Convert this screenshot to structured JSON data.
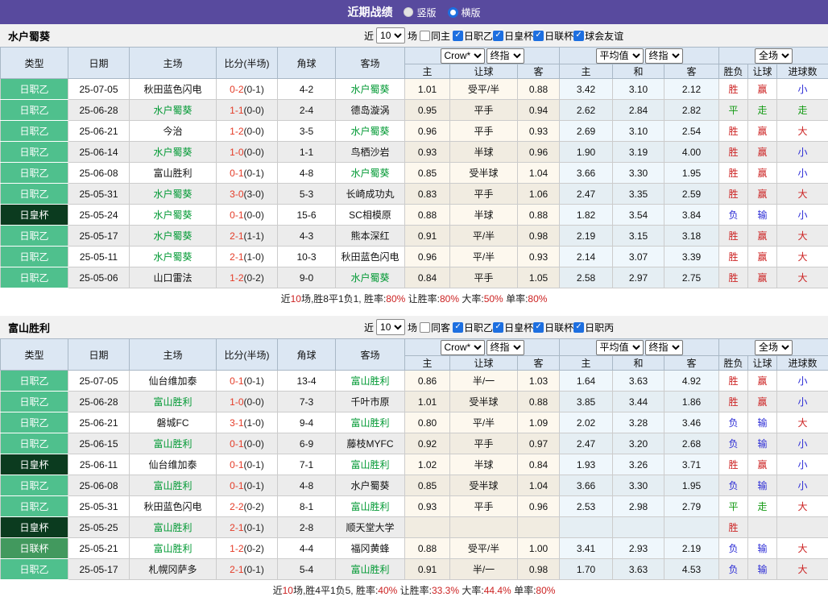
{
  "colors": {
    "topbar": "#584a9e",
    "headerBg": "#dce7f3",
    "check": "#1d6fe0",
    "j2": "#4fc08d",
    "cup": "#0b3b1f",
    "lc": "#42995e",
    "hl": "#009933",
    "score": "#e43c28",
    "red": "#cc2222",
    "green": "#149a14",
    "blue": "#2b2bd5",
    "cream": "#fdf8ee",
    "avg": "#eff7fc"
  },
  "topbar": {
    "title": "近期战绩",
    "options": [
      {
        "label": "竖版",
        "checked": false
      },
      {
        "label": "横版",
        "checked": true
      }
    ]
  },
  "sections": [
    {
      "team": "水户蜀葵",
      "filter": {
        "near": "近",
        "count": "10",
        "games": "场",
        "same_label": "同主",
        "leagues": [
          "日职乙",
          "日皇杯",
          "日联杯",
          "球会友谊"
        ]
      },
      "header": {
        "left": [
          "类型",
          "日期",
          "主场",
          "比分(半场)",
          "角球",
          "客场"
        ],
        "selects": [
          "Crow*",
          "终指",
          "平均值",
          "终指",
          "全场"
        ],
        "sub": [
          "主",
          "让球",
          "客",
          "主",
          "和",
          "客",
          "胜负",
          "让球",
          "进球数"
        ]
      },
      "rows": [
        {
          "type": "日职乙",
          "date": "25-07-05",
          "home": "秋田蓝色闪电",
          "home_hl": false,
          "ft": "0-2",
          "ht": "(0-1)",
          "corner": "4-2",
          "away": "水户蜀葵",
          "away_hl": true,
          "crow": [
            "1.01",
            "受平/半",
            "0.88"
          ],
          "avg": [
            "3.42",
            "3.10",
            "2.12"
          ],
          "res": [
            "胜",
            "赢",
            "小"
          ]
        },
        {
          "type": "日职乙",
          "date": "25-06-28",
          "home": "水户蜀葵",
          "home_hl": true,
          "ft": "1-1",
          "ht": "(0-0)",
          "corner": "2-4",
          "away": "德岛漩涡",
          "away_hl": false,
          "crow": [
            "0.95",
            "平手",
            "0.94"
          ],
          "avg": [
            "2.62",
            "2.84",
            "2.82"
          ],
          "res": [
            "平",
            "走",
            "走"
          ]
        },
        {
          "type": "日职乙",
          "date": "25-06-21",
          "home": "今治",
          "home_hl": false,
          "ft": "1-2",
          "ht": "(0-0)",
          "corner": "3-5",
          "away": "水户蜀葵",
          "away_hl": true,
          "crow": [
            "0.96",
            "平手",
            "0.93"
          ],
          "avg": [
            "2.69",
            "3.10",
            "2.54"
          ],
          "res": [
            "胜",
            "赢",
            "大"
          ]
        },
        {
          "type": "日职乙",
          "date": "25-06-14",
          "home": "水户蜀葵",
          "home_hl": true,
          "ft": "1-0",
          "ht": "(0-0)",
          "corner": "1-1",
          "away": "鸟栖沙岩",
          "away_hl": false,
          "crow": [
            "0.93",
            "半球",
            "0.96"
          ],
          "avg": [
            "1.90",
            "3.19",
            "4.00"
          ],
          "res": [
            "胜",
            "赢",
            "小"
          ]
        },
        {
          "type": "日职乙",
          "date": "25-06-08",
          "home": "富山胜利",
          "home_hl": false,
          "ft": "0-1",
          "ht": "(0-1)",
          "corner": "4-8",
          "away": "水户蜀葵",
          "away_hl": true,
          "crow": [
            "0.85",
            "受半球",
            "1.04"
          ],
          "avg": [
            "3.66",
            "3.30",
            "1.95"
          ],
          "res": [
            "胜",
            "赢",
            "小"
          ]
        },
        {
          "type": "日职乙",
          "date": "25-05-31",
          "home": "水户蜀葵",
          "home_hl": true,
          "ft": "3-0",
          "ht": "(3-0)",
          "corner": "5-3",
          "away": "长崎成功丸",
          "away_hl": false,
          "crow": [
            "0.83",
            "平手",
            "1.06"
          ],
          "avg": [
            "2.47",
            "3.35",
            "2.59"
          ],
          "res": [
            "胜",
            "赢",
            "大"
          ]
        },
        {
          "type": "日皇杯",
          "date": "25-05-24",
          "home": "水户蜀葵",
          "home_hl": true,
          "ft": "0-1",
          "ht": "(0-0)",
          "corner": "15-6",
          "away": "SC相模原",
          "away_hl": false,
          "crow": [
            "0.88",
            "半球",
            "0.88"
          ],
          "avg": [
            "1.82",
            "3.54",
            "3.84"
          ],
          "res": [
            "负",
            "输",
            "小"
          ]
        },
        {
          "type": "日职乙",
          "date": "25-05-17",
          "home": "水户蜀葵",
          "home_hl": true,
          "ft": "2-1",
          "ht": "(1-1)",
          "corner": "4-3",
          "away": "熊本深红",
          "away_hl": false,
          "crow": [
            "0.91",
            "平/半",
            "0.98"
          ],
          "avg": [
            "2.19",
            "3.15",
            "3.18"
          ],
          "res": [
            "胜",
            "赢",
            "大"
          ]
        },
        {
          "type": "日职乙",
          "date": "25-05-11",
          "home": "水户蜀葵",
          "home_hl": true,
          "ft": "2-1",
          "ht": "(1-0)",
          "corner": "10-3",
          "away": "秋田蓝色闪电",
          "away_hl": false,
          "crow": [
            "0.96",
            "平/半",
            "0.93"
          ],
          "avg": [
            "2.14",
            "3.07",
            "3.39"
          ],
          "res": [
            "胜",
            "赢",
            "大"
          ]
        },
        {
          "type": "日职乙",
          "date": "25-05-06",
          "home": "山口雷法",
          "home_hl": false,
          "ft": "1-2",
          "ht": "(0-2)",
          "corner": "9-0",
          "away": "水户蜀葵",
          "away_hl": true,
          "crow": [
            "0.84",
            "平手",
            "1.05"
          ],
          "avg": [
            "2.58",
            "2.97",
            "2.75"
          ],
          "res": [
            "胜",
            "赢",
            "大"
          ]
        }
      ],
      "summary": [
        [
          "近",
          "b"
        ],
        [
          "10",
          "r"
        ],
        [
          "场,胜8平1负1, 胜率:",
          "b"
        ],
        [
          "80%",
          "r"
        ],
        [
          " 让胜率:",
          "b"
        ],
        [
          "80%",
          "r"
        ],
        [
          " 大率:",
          "b"
        ],
        [
          "50%",
          "r"
        ],
        [
          " 单率:",
          "b"
        ],
        [
          "80%",
          "r"
        ]
      ]
    },
    {
      "team": "富山胜利",
      "filter": {
        "near": "近",
        "count": "10",
        "games": "场",
        "same_label": "同客",
        "leagues": [
          "日职乙",
          "日皇杯",
          "日联杯",
          "日职丙"
        ]
      },
      "header": {
        "left": [
          "类型",
          "日期",
          "主场",
          "比分(半场)",
          "角球",
          "客场"
        ],
        "selects": [
          "Crow*",
          "终指",
          "平均值",
          "终指",
          "全场"
        ],
        "sub": [
          "主",
          "让球",
          "客",
          "主",
          "和",
          "客",
          "胜负",
          "让球",
          "进球数"
        ]
      },
      "rows": [
        {
          "type": "日职乙",
          "date": "25-07-05",
          "home": "仙台维加泰",
          "home_hl": false,
          "ft": "0-1",
          "ht": "(0-1)",
          "corner": "13-4",
          "away": "富山胜利",
          "away_hl": true,
          "crow": [
            "0.86",
            "半/一",
            "1.03"
          ],
          "avg": [
            "1.64",
            "3.63",
            "4.92"
          ],
          "res": [
            "胜",
            "赢",
            "小"
          ]
        },
        {
          "type": "日职乙",
          "date": "25-06-28",
          "home": "富山胜利",
          "home_hl": true,
          "ft": "1-0",
          "ht": "(0-0)",
          "corner": "7-3",
          "away": "千叶市原",
          "away_hl": false,
          "crow": [
            "1.01",
            "受半球",
            "0.88"
          ],
          "avg": [
            "3.85",
            "3.44",
            "1.86"
          ],
          "res": [
            "胜",
            "赢",
            "小"
          ]
        },
        {
          "type": "日职乙",
          "date": "25-06-21",
          "home": "磐城FC",
          "home_hl": false,
          "ft": "3-1",
          "ht": "(1-0)",
          "corner": "9-4",
          "away": "富山胜利",
          "away_hl": true,
          "crow": [
            "0.80",
            "平/半",
            "1.09"
          ],
          "avg": [
            "2.02",
            "3.28",
            "3.46"
          ],
          "res": [
            "负",
            "输",
            "大"
          ]
        },
        {
          "type": "日职乙",
          "date": "25-06-15",
          "home": "富山胜利",
          "home_hl": true,
          "ft": "0-1",
          "ht": "(0-0)",
          "corner": "6-9",
          "away": "藤枝MYFC",
          "away_hl": false,
          "crow": [
            "0.92",
            "平手",
            "0.97"
          ],
          "avg": [
            "2.47",
            "3.20",
            "2.68"
          ],
          "res": [
            "负",
            "输",
            "小"
          ]
        },
        {
          "type": "日皇杯",
          "date": "25-06-11",
          "home": "仙台维加泰",
          "home_hl": false,
          "ft": "0-1",
          "ht": "(0-1)",
          "corner": "7-1",
          "away": "富山胜利",
          "away_hl": true,
          "crow": [
            "1.02",
            "半球",
            "0.84"
          ],
          "avg": [
            "1.93",
            "3.26",
            "3.71"
          ],
          "res": [
            "胜",
            "赢",
            "小"
          ]
        },
        {
          "type": "日职乙",
          "date": "25-06-08",
          "home": "富山胜利",
          "home_hl": true,
          "ft": "0-1",
          "ht": "(0-1)",
          "corner": "4-8",
          "away": "水户蜀葵",
          "away_hl": false,
          "crow": [
            "0.85",
            "受半球",
            "1.04"
          ],
          "avg": [
            "3.66",
            "3.30",
            "1.95"
          ],
          "res": [
            "负",
            "输",
            "小"
          ]
        },
        {
          "type": "日职乙",
          "date": "25-05-31",
          "home": "秋田蓝色闪电",
          "home_hl": false,
          "ft": "2-2",
          "ht": "(0-2)",
          "corner": "8-1",
          "away": "富山胜利",
          "away_hl": true,
          "crow": [
            "0.93",
            "平手",
            "0.96"
          ],
          "avg": [
            "2.53",
            "2.98",
            "2.79"
          ],
          "res": [
            "平",
            "走",
            "大"
          ]
        },
        {
          "type": "日皇杯",
          "date": "25-05-25",
          "home": "富山胜利",
          "home_hl": true,
          "ft": "2-1",
          "ht": "(0-1)",
          "corner": "2-8",
          "away": "顺天堂大学",
          "away_hl": false,
          "crow": [
            "",
            "",
            ""
          ],
          "avg": [
            "",
            "",
            ""
          ],
          "res": [
            "胜",
            "",
            ""
          ]
        },
        {
          "type": "日联杯",
          "date": "25-05-21",
          "home": "富山胜利",
          "home_hl": true,
          "ft": "1-2",
          "ht": "(0-2)",
          "corner": "4-4",
          "away": "福冈黄蜂",
          "away_hl": false,
          "crow": [
            "0.88",
            "受平/半",
            "1.00"
          ],
          "avg": [
            "3.41",
            "2.93",
            "2.19"
          ],
          "res": [
            "负",
            "输",
            "大"
          ]
        },
        {
          "type": "日职乙",
          "date": "25-05-17",
          "home": "札幌冈萨多",
          "home_hl": false,
          "ft": "2-1",
          "ht": "(0-1)",
          "corner": "5-4",
          "away": "富山胜利",
          "away_hl": true,
          "crow": [
            "0.91",
            "半/一",
            "0.98"
          ],
          "avg": [
            "1.70",
            "3.63",
            "4.53"
          ],
          "res": [
            "负",
            "输",
            "大"
          ]
        }
      ],
      "summary": [
        [
          "近",
          "b"
        ],
        [
          "10",
          "r"
        ],
        [
          "场,胜4平1负5, 胜率:",
          "b"
        ],
        [
          "40%",
          "r"
        ],
        [
          " 让胜率:",
          "b"
        ],
        [
          "33.3%",
          "r"
        ],
        [
          " 大率:",
          "b"
        ],
        [
          "44.4%",
          "r"
        ],
        [
          " 单率:",
          "b"
        ],
        [
          "80%",
          "r"
        ]
      ]
    }
  ]
}
